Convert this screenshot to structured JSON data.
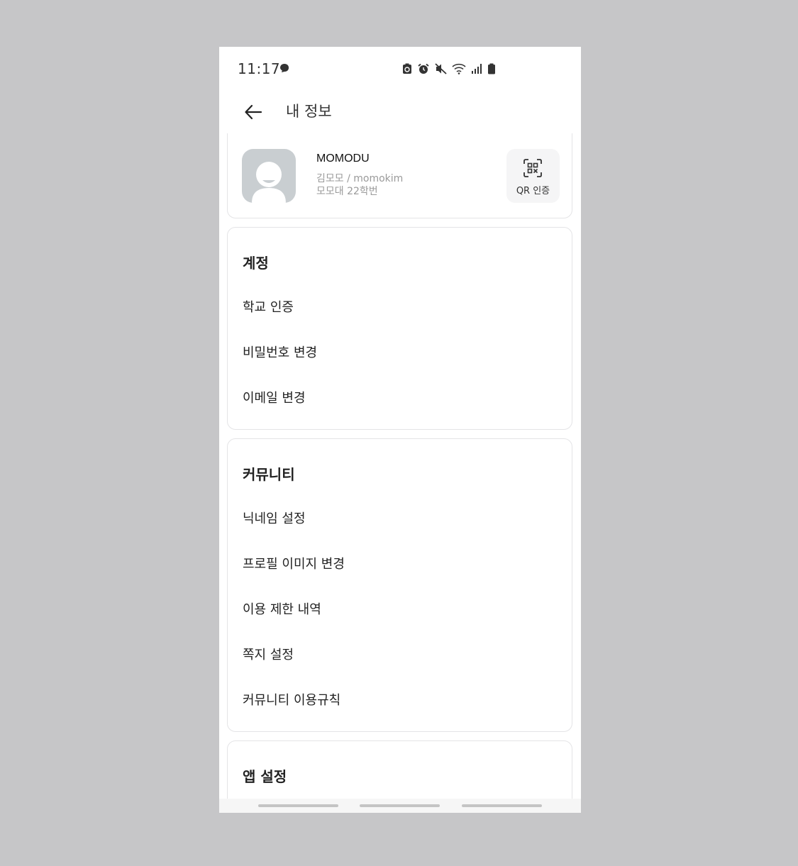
{
  "status_bar": {
    "time": "11:17",
    "icons": [
      "chat-icon",
      "battery-saver-icon",
      "alarm-icon",
      "mute-icon",
      "wifi-icon",
      "signal-icon",
      "battery-icon"
    ]
  },
  "header": {
    "title": "내 정보",
    "back_icon": "arrow-left-icon"
  },
  "profile": {
    "nickname": "MOMODU",
    "name_id": "김모모 / momokim",
    "school": "모모대 22학번",
    "qr_label": "QR 인증"
  },
  "account": {
    "title": "계정",
    "items": [
      "학교 인증",
      "비밀번호 변경",
      "이메일 변경"
    ]
  },
  "community": {
    "title": "커뮤니티",
    "items": [
      "닉네임 설정",
      "프로필 이미지 변경",
      "이용 제한 내역",
      "쪽지 설정",
      "커뮤니티 이용규칙"
    ]
  },
  "app_settings": {
    "title": "앱 설정"
  },
  "colors": {
    "background": "#c6c6c8",
    "avatar": "#c9ced1",
    "border": "#e4e4e6",
    "subtext": "#9a9a9a"
  }
}
